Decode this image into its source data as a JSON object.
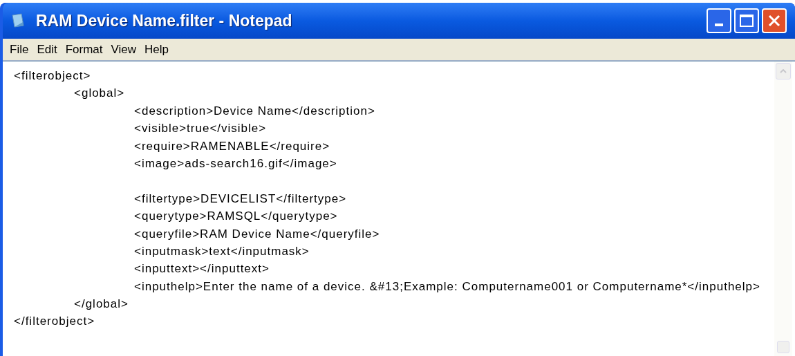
{
  "window": {
    "title": "RAM Device Name.filter - Notepad"
  },
  "menu": [
    "File",
    "Edit",
    "Format",
    "View",
    "Help"
  ],
  "paragraphs": [
    [
      "<filterobject>",
      "\t<global>",
      "\t\t<description>Device Name</description>",
      "\t\t<visible>true</visible>",
      "\t\t<require>RAMENABLE</require>",
      "\t\t<image>ads-search16.gif</image>"
    ],
    [
      "\t\t<filtertype>DEVICELIST</filtertype>",
      "\t\t<querytype>RAMSQL</querytype>",
      "\t\t<queryfile>RAM Device Name</queryfile>",
      "\t\t<inputmask>text</inputmask>",
      "\t\t<inputtext></inputtext>",
      "\t\t<inputhelp>Enter the name of a device. &#13;Example: Computername001 or Computername*</inputhelp>",
      "\t</global>",
      "</filterobject>"
    ]
  ]
}
